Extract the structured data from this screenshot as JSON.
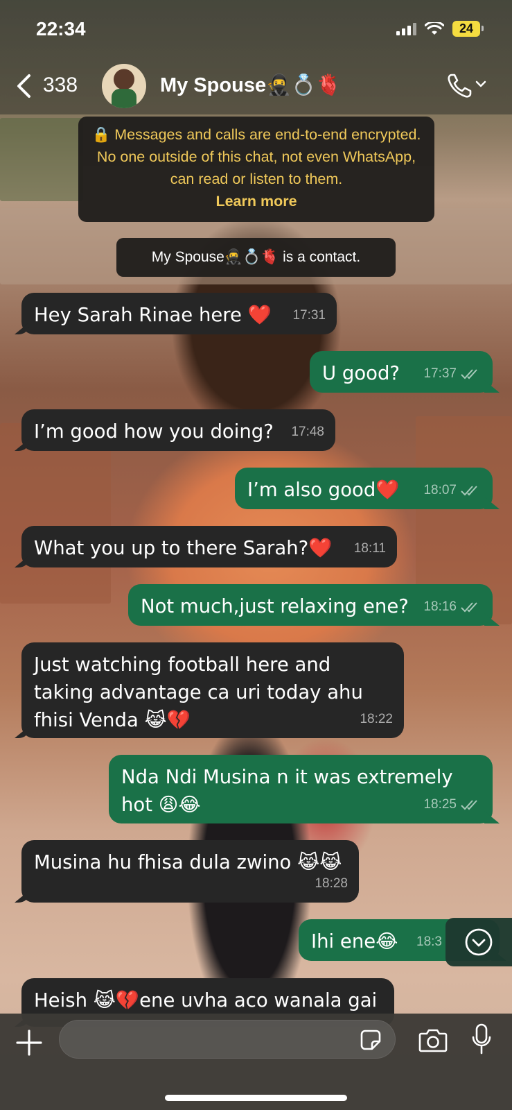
{
  "status_bar": {
    "time": "22:34",
    "battery": "24"
  },
  "header": {
    "back_count": "338",
    "contact_name": "My Spouse🥷💍🫀"
  },
  "notices": {
    "encryption_text": "🔒 Messages and calls are end-to-end encrypted. No one outside of this chat, not even WhatsApp, can read or listen to them.",
    "learn_more": "Learn more",
    "contact_notice": "My Spouse🥷💍🫀 is a contact."
  },
  "messages": [
    {
      "dir": "in",
      "text": "Hey Sarah Rinae here ❤️",
      "time": "17:31"
    },
    {
      "dir": "out",
      "text": "U good?",
      "time": "17:37"
    },
    {
      "dir": "in",
      "text": "I’m good how you doing?",
      "time": "17:48"
    },
    {
      "dir": "out",
      "text": "I’m also good❤️",
      "time": "18:07"
    },
    {
      "dir": "in",
      "text": "What you up to there Sarah?❤️",
      "time": "18:11"
    },
    {
      "dir": "out",
      "text": "Not much,just relaxing ene?",
      "time": "18:16"
    },
    {
      "dir": "in",
      "text": "Just watching football here and taking advantage ca uri today ahu fhisi Venda 😹💔",
      "time": "18:22"
    },
    {
      "dir": "out",
      "text": "Nda Ndi Musina n it was extremely hot 😩😂",
      "time": "18:25"
    },
    {
      "dir": "in",
      "text": "Musina hu fhisa dula zwino 😹😹",
      "time": "18:28"
    },
    {
      "dir": "out",
      "text": "Ihi ene😂",
      "time": "18:3"
    },
    {
      "dir": "in",
      "text": "Heish 😹💔ene uvha aco wanala gai",
      "time": ""
    }
  ],
  "input": {
    "placeholder": ""
  },
  "colors": {
    "incoming": "#262626",
    "outgoing": "#1a7148",
    "notice_text": "#f0c95a"
  },
  "icons": [
    "back-chevron-icon",
    "call-icon",
    "chevron-down-icon",
    "plus-icon",
    "sticker-icon",
    "camera-icon",
    "mic-icon",
    "scroll-down-icon"
  ]
}
